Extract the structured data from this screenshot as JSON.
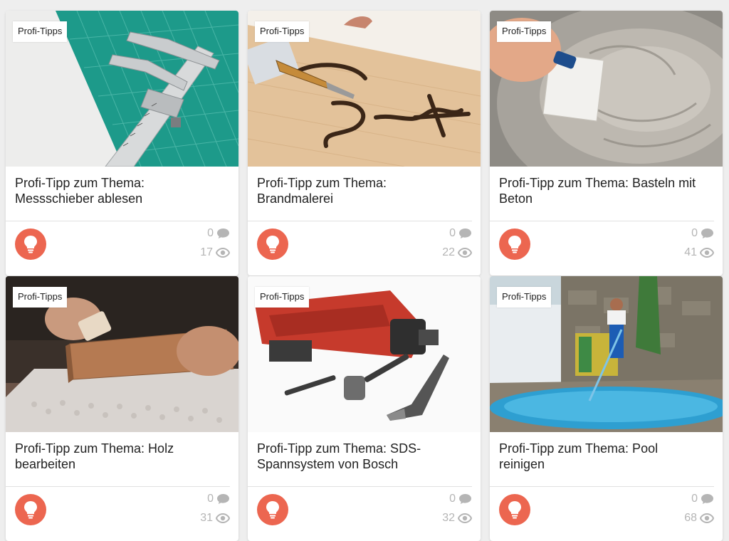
{
  "cards": [
    {
      "tag": "Profi-Tipps",
      "title": "Profi-Tipp zum Thema: Messschieber ablesen",
      "comments": "0",
      "views": "17",
      "image": "caliper"
    },
    {
      "tag": "Profi-Tipps",
      "title": "Profi-Tipp zum Thema: Brandmalerei",
      "comments": "0",
      "views": "22",
      "image": "woodburning"
    },
    {
      "tag": "Profi-Tipps",
      "title": "Profi-Tipp zum Thema: Basteln mit Beton",
      "comments": "0",
      "views": "41",
      "image": "concrete"
    },
    {
      "tag": "Profi-Tipps",
      "title": "Profi-Tipp zum Thema: Holz bearbeiten",
      "comments": "0",
      "views": "31",
      "image": "wood-sanding"
    },
    {
      "tag": "Profi-Tipps",
      "title": "Profi-Tipp zum Thema: SDS-Spannsystem von Bosch",
      "comments": "0",
      "views": "32",
      "image": "drill-bits"
    },
    {
      "tag": "Profi-Tipps",
      "title": "Profi-Tipp zum Thema: Pool reinigen",
      "comments": "0",
      "views": "68",
      "image": "pool-cleaning"
    }
  ],
  "colors": {
    "accent": "#ec6650",
    "muted": "#b5b5b5"
  },
  "icons": {
    "category": "lightbulb-icon",
    "comments": "speech-bubble-icon",
    "views": "eye-icon"
  }
}
